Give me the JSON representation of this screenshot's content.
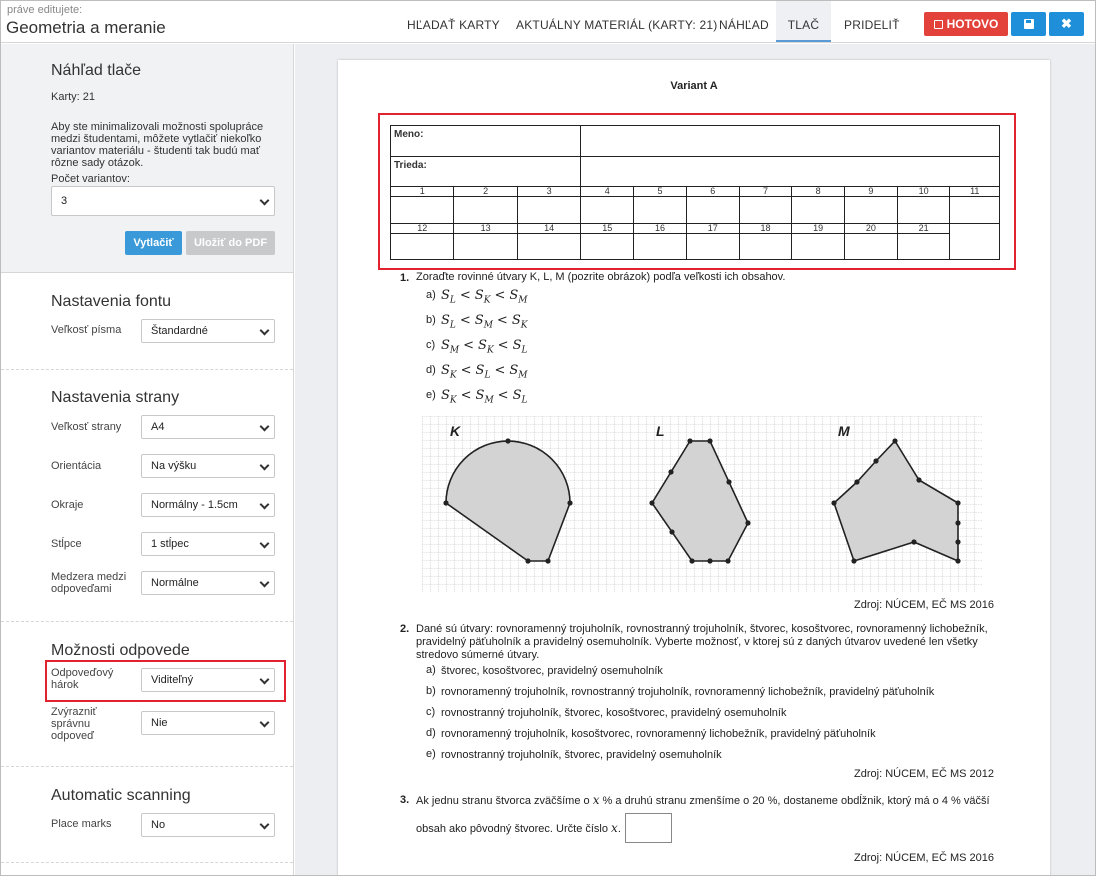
{
  "header": {
    "editing_label": "práve editujete:",
    "doc_title": "Geometria a meranie",
    "tabs": [
      "HĽADAŤ KARTY",
      "AKTUÁLNY MATERIÁL (KARTY: 21)",
      "NÁHĽAD",
      "TLAČ",
      "PRIDELIŤ"
    ],
    "active_tab": "TLAČ",
    "done_label": "HOTOVO",
    "close_glyph": "✖",
    "colors": {
      "done": "#e3423a",
      "action": "#1e8fd8",
      "active_tab_underline": "#5b9bd5"
    }
  },
  "sidebar": {
    "print_preview": {
      "title": "Náhľad tlače",
      "cards": "Karty: 21",
      "description": "Aby ste minimalizovali možnosti spolupráce medzi študentami, môžete vytlačiť niekoľko variantov materiálu - študenti tak budú mať rôzne sady otázok.",
      "variants_label": "Počet variantov:",
      "variants_value": "3",
      "print_button": "Vytlačiť",
      "pdf_button": "Uložiť do PDF"
    },
    "font_settings": {
      "title": "Nastavenia fontu",
      "font_size_label": "Veľkosť písma",
      "font_size_value": "Štandardné"
    },
    "page_settings": {
      "title": "Nastavenia strany",
      "page_size_label": "Veľkosť strany",
      "page_size_value": "A4",
      "orientation_label": "Orientácia",
      "orientation_value": "Na výšku",
      "margins_label": "Okraje",
      "margins_value": "Normálny - 1.5cm",
      "columns_label": "Stĺpce",
      "columns_value": "1 stĺpec",
      "spacing_label_1": "Medzera medzi",
      "spacing_label_2": "odpoveďami",
      "spacing_value": "Normálne"
    },
    "answer_options": {
      "title": "Možnosti odpovede",
      "sheet_label_1": "Odpoveďový",
      "sheet_label_2": "hárok",
      "sheet_value": "Viditeľný",
      "highlight_label_1": "Zvýrazniť",
      "highlight_label_2": "správnu",
      "highlight_label_3": "odpoveď",
      "highlight_value": "Nie"
    },
    "scanning": {
      "title": "Automatic scanning",
      "place_marks_label": "Place marks",
      "place_marks_value": "No"
    }
  },
  "paper": {
    "variant": "Variant A",
    "sheet": {
      "name_label": "Meno:",
      "class_label": "Trieda:",
      "row1_numbers": [
        "1",
        "2",
        "3",
        "4",
        "5",
        "6",
        "7",
        "8",
        "9",
        "10",
        "11"
      ],
      "row2_numbers": [
        "12",
        "13",
        "14",
        "15",
        "16",
        "17",
        "18",
        "19",
        "20",
        "21"
      ]
    },
    "q1": {
      "num": "1.",
      "text": "Zoraďte rovinné útvary K, L, M (pozrite obrázok) podľa veľkosti ich obsahov.",
      "options": [
        {
          "letter": "a)",
          "text": "S_L < S_K < S_M"
        },
        {
          "letter": "b)",
          "text": "S_L < S_M < S_K"
        },
        {
          "letter": "c)",
          "text": "S_M < S_K < S_L"
        },
        {
          "letter": "d)",
          "text": "S_K < S_L < S_M"
        },
        {
          "letter": "e)",
          "text": "S_K < S_M < S_L"
        }
      ],
      "figure_labels": [
        "K",
        "L",
        "M"
      ],
      "source": "Zdroj: NÚCEM, EČ MS 2016"
    },
    "q2": {
      "num": "2.",
      "line1": "Dané sú útvary: rovnoramenný trojuholník, rovnostranný trojuholník, štvorec, kosoštvorec, rovnoramenný lichobežník,",
      "line2": "pravidelný päťuholník a pravidelný osemuholník. Vyberte možnosť, v ktorej sú z daných útvarov uvedené len všetky",
      "line3": "stredovo súmerné útvary.",
      "options": [
        {
          "letter": "a)",
          "text": "štvorec, kosoštvorec, pravidelný osemuholník"
        },
        {
          "letter": "b)",
          "text": "rovnoramenný trojuholník, rovnostranný trojuholník, rovnoramenný lichobežník, pravidelný päťuholník"
        },
        {
          "letter": "c)",
          "text": "rovnostranný trojuholník, štvorec, kosoštvorec, pravidelný osemuholník"
        },
        {
          "letter": "d)",
          "text": "rovnoramenný trojuholník, kosoštvorec, rovnoramenný lichobežník, pravidelný päťuholník"
        },
        {
          "letter": "e)",
          "text": "rovnostranný trojuholník, štvorec, pravidelný osemuholník"
        }
      ],
      "source": "Zdroj: NÚCEM, EČ MS 2012"
    },
    "q3": {
      "num": "3.",
      "line1": "Ak jednu stranu štvorca zväčšíme o x % a druhú stranu zmenšíme o 20 %, dostaneme obdĺžnik, ktorý má o 4 % väčší",
      "line2": "obsah ako pôvodný štvorec. Určte číslo x.",
      "source": "Zdroj: NÚCEM, EČ MS 2016"
    }
  }
}
